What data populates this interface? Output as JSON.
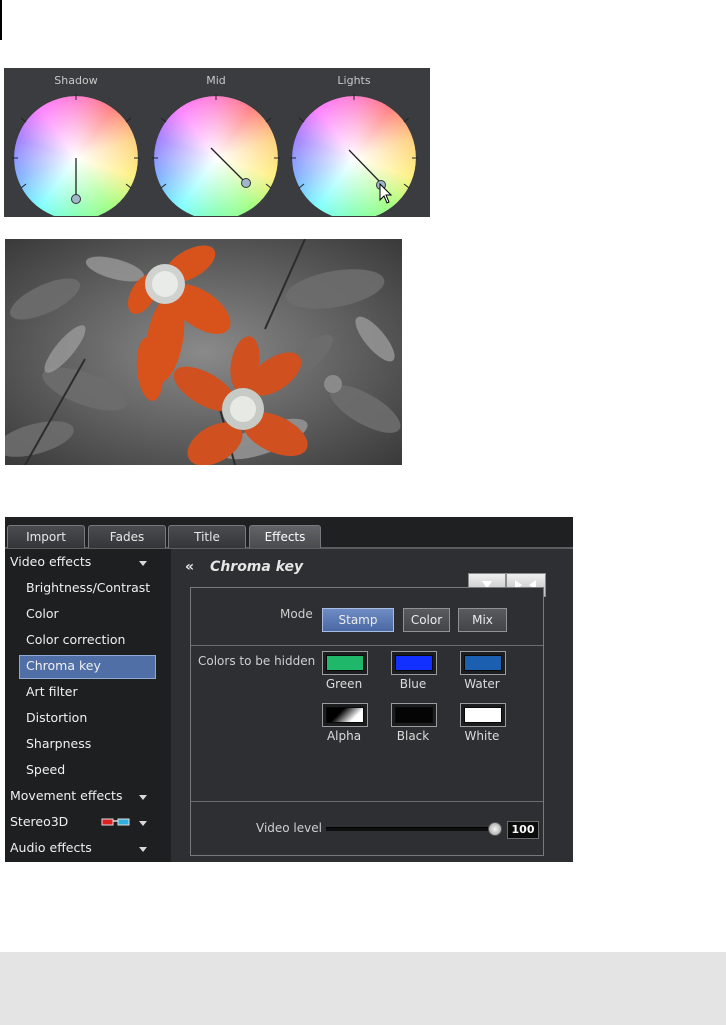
{
  "wheels": [
    {
      "label": "Shadow"
    },
    {
      "label": "Mid"
    },
    {
      "label": "Lights"
    }
  ],
  "photo": {
    "subject": "orange flower on black-and-white background"
  },
  "tabs": [
    {
      "label": "Import",
      "active": false
    },
    {
      "label": "Fades",
      "active": false
    },
    {
      "label": "Title",
      "active": false
    },
    {
      "label": "Effects",
      "active": true
    }
  ],
  "sidebar": {
    "video_effects": "Video effects",
    "items": [
      "Brightness/Contrast",
      "Color",
      "Color correction",
      "Chroma key",
      "Art filter",
      "Distortion",
      "Sharpness",
      "Speed"
    ],
    "selected": "Chroma key",
    "movement_effects": "Movement effects",
    "stereo3d": "Stereo3D",
    "audio_effects": "Audio effects"
  },
  "main": {
    "back_icon": "«",
    "title": "Chroma key",
    "menu_button": "▼",
    "collapse_button": "►◄",
    "mode_label": "Mode",
    "modes": [
      "Stamp",
      "Color",
      "Mix"
    ],
    "active_mode": "Stamp",
    "hidden_label": "Colors to be hidden",
    "swatches": [
      {
        "label": "Green",
        "color": "#1fb86a"
      },
      {
        "label": "Blue",
        "color": "#1230ff"
      },
      {
        "label": "Water",
        "color": "#1a5fb0"
      },
      {
        "label": "Alpha",
        "color": "gradient"
      },
      {
        "label": "Black",
        "color": "#050505"
      },
      {
        "label": "White",
        "color": "#ffffff"
      }
    ],
    "video_level_label": "Video level",
    "video_level_value": "100"
  }
}
